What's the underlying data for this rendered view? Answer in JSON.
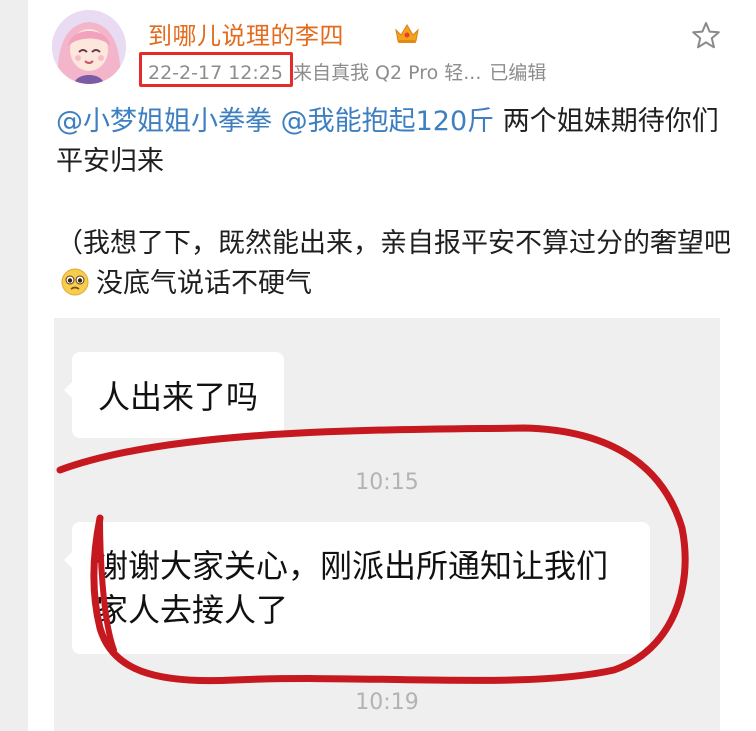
{
  "post": {
    "username": "到哪儿说理的李四",
    "timestamp": "22-2-17 12:25",
    "source": "来自真我 Q2 Pro 轻...",
    "edited": "已编辑",
    "mention1": "@小梦姐姐小拳拳",
    "mention2": "@我能抱起120斤",
    "line1_rest": " 两个姐妹期待你们平安归来",
    "para2_before_emoji": "（我想了下，既然能出来，亲自报平安不算过分的奢望吧",
    "para2_after_emoji": "没底气说话不硬气"
  },
  "icons": {
    "badge": "crown-badge-icon",
    "favorite": "star-outline-icon",
    "emoji": "pleading-face-emoji"
  },
  "image": {
    "msg1": "人出来了吗",
    "time1": "10:15",
    "msg2": "谢谢大家关心，刚派出所通知让我们家人去接人了",
    "time2": "10:19"
  },
  "colors": {
    "username": "#e46b1c",
    "mention": "#3d7fc1",
    "highlight_box": "#e42c2c",
    "marker_circle": "#c6181f"
  }
}
